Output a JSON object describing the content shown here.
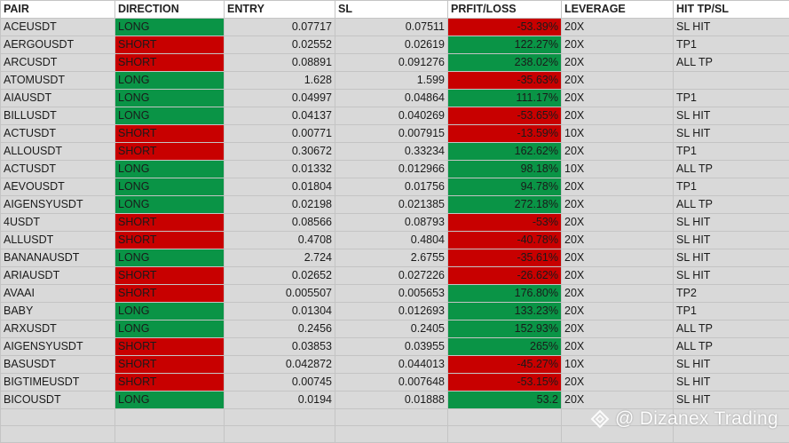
{
  "sheet": {
    "headers": [
      "PAIR",
      "DIRECTION",
      "ENTRY",
      "SL",
      "PRFIT/LOSS",
      "LEVERAGE",
      "HIT TP/SL"
    ],
    "rows": [
      {
        "pair": "ACEUSDT",
        "direction": "LONG",
        "entry": "0.07717",
        "sl": "0.07511",
        "pl": "-53.39%",
        "leverage": "20X",
        "hit": "SL HIT"
      },
      {
        "pair": "AERGOUSDT",
        "direction": "SHORT",
        "entry": "0.02552",
        "sl": "0.02619",
        "pl": "122.27%",
        "leverage": "20X",
        "hit": "TP1"
      },
      {
        "pair": "ARCUSDT",
        "direction": "SHORT",
        "entry": "0.08891",
        "sl": "0.091276",
        "pl": "238.02%",
        "leverage": "20X",
        "hit": "ALL TP"
      },
      {
        "pair": "ATOMUSDT",
        "direction": "LONG",
        "entry": "1.628",
        "sl": "1.599",
        "pl": "-35.63%",
        "leverage": "20X",
        "hit": ""
      },
      {
        "pair": "AIAUSDT",
        "direction": "LONG",
        "entry": "0.04997",
        "sl": "0.04864",
        "pl": "111.17%",
        "leverage": "20X",
        "hit": "TP1"
      },
      {
        "pair": "BILLUSDT",
        "direction": "LONG",
        "entry": "0.04137",
        "sl": "0.040269",
        "pl": "-53.65%",
        "leverage": "20X",
        "hit": "SL HIT"
      },
      {
        "pair": "ACTUSDT",
        "direction": "SHORT",
        "entry": "0.00771",
        "sl": "0.007915",
        "pl": "-13.59%",
        "leverage": "10X",
        "hit": "SL HIT"
      },
      {
        "pair": "ALLOUSDT",
        "direction": "SHORT",
        "entry": "0.30672",
        "sl": "0.33234",
        "pl": "162.62%",
        "leverage": "20X",
        "hit": "TP1"
      },
      {
        "pair": "ACTUSDT",
        "direction": "LONG",
        "entry": "0.01332",
        "sl": "0.012966",
        "pl": "98.18%",
        "leverage": "10X",
        "hit": "ALL TP"
      },
      {
        "pair": "AEVOUSDT",
        "direction": "LONG",
        "entry": "0.01804",
        "sl": "0.01756",
        "pl": "94.78%",
        "leverage": "20X",
        "hit": "TP1"
      },
      {
        "pair": "AIGENSYUSDT",
        "direction": "LONG",
        "entry": "0.02198",
        "sl": "0.021385",
        "pl": "272.18%",
        "leverage": "20X",
        "hit": "ALL TP"
      },
      {
        "pair": "4USDT",
        "direction": "SHORT",
        "entry": "0.08566",
        "sl": "0.08793",
        "pl": "-53%",
        "leverage": "20X",
        "hit": "SL HIT"
      },
      {
        "pair": "ALLUSDT",
        "direction": "SHORT",
        "entry": "0.4708",
        "sl": "0.4804",
        "pl": "-40.78%",
        "leverage": "20X",
        "hit": "SL HIT"
      },
      {
        "pair": "BANANAUSDT",
        "direction": "LONG",
        "entry": "2.724",
        "sl": "2.6755",
        "pl": "-35.61%",
        "leverage": "20X",
        "hit": "SL HIT"
      },
      {
        "pair": "ARIAUSDT",
        "direction": "SHORT",
        "entry": "0.02652",
        "sl": "0.027226",
        "pl": "-26.62%",
        "leverage": "20X",
        "hit": "SL HIT"
      },
      {
        "pair": "AVAAI",
        "direction": "SHORT",
        "entry": "0.005507",
        "sl": "0.005653",
        "pl": "176.80%",
        "leverage": "20X",
        "hit": "TP2"
      },
      {
        "pair": "BABY",
        "direction": "LONG",
        "entry": "0.01304",
        "sl": "0.012693",
        "pl": "133.23%",
        "leverage": "20X",
        "hit": "TP1"
      },
      {
        "pair": "ARXUSDT",
        "direction": "LONG",
        "entry": "0.2456",
        "sl": "0.2405",
        "pl": "152.93%",
        "leverage": "20X",
        "hit": "ALL TP"
      },
      {
        "pair": "AIGENSYUSDT",
        "direction": "SHORT",
        "entry": "0.03853",
        "sl": "0.03955",
        "pl": "265%",
        "leverage": "20X",
        "hit": "ALL TP"
      },
      {
        "pair": "BASUSDT",
        "direction": "SHORT",
        "entry": "0.042872",
        "sl": "0.044013",
        "pl": "-45.27%",
        "leverage": "10X",
        "hit": "SL HIT"
      },
      {
        "pair": "BIGTIMEUSDT",
        "direction": "SHORT",
        "entry": "0.00745",
        "sl": "0.007648",
        "pl": "-53.15%",
        "leverage": "20X",
        "hit": "SL HIT"
      },
      {
        "pair": "BICOUSDT",
        "direction": "LONG",
        "entry": "0.0194",
        "sl": "0.01888",
        "pl": "53.2",
        "leverage": "20X",
        "hit": "SL HIT"
      }
    ],
    "colors": {
      "long": "#0a9446",
      "short": "#c80000",
      "profit": "#0a9446",
      "loss": "#c80000",
      "grid": "#c4c4c4",
      "cell": "#d9d9d9",
      "header": "#ffffff"
    }
  },
  "watermark": {
    "icon": "diamond-logo-icon",
    "text": "@ Dizanex Trading"
  }
}
